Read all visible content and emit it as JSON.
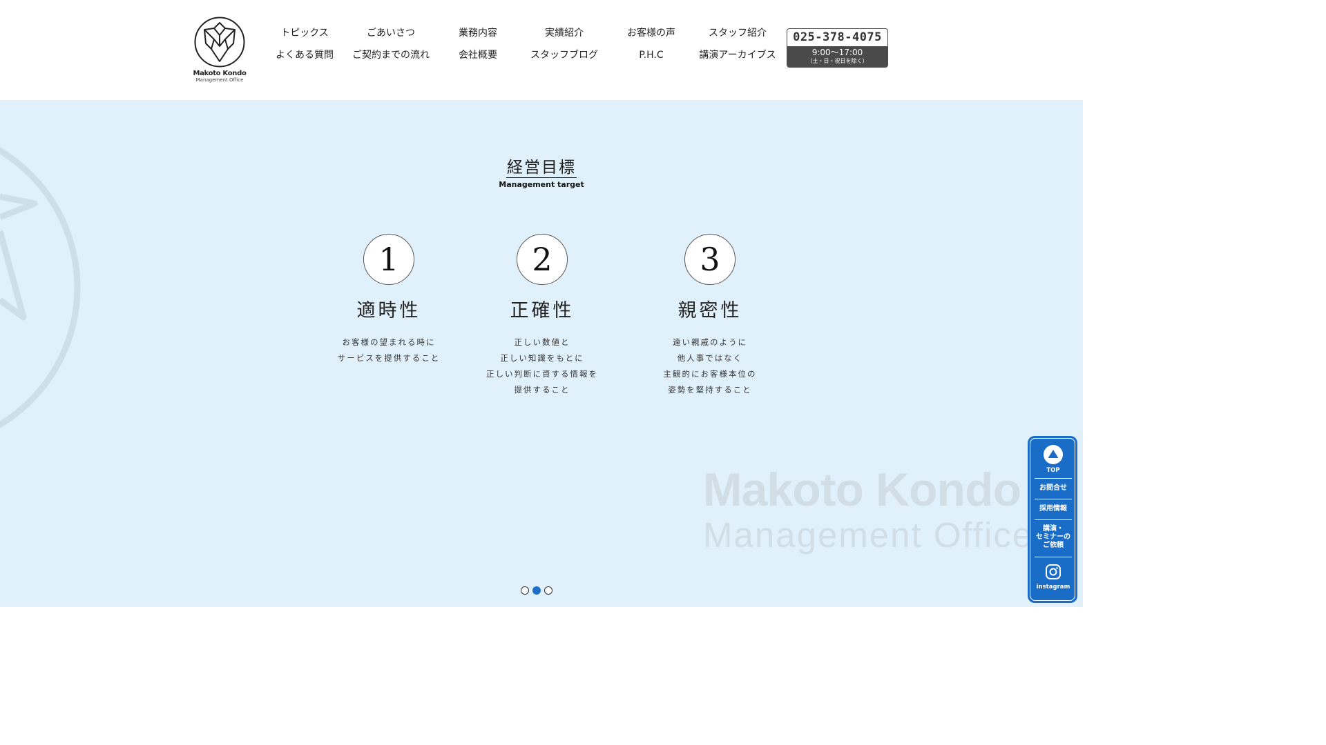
{
  "logo": {
    "name": "Makoto Kondo",
    "sub": "Management Office"
  },
  "nav": {
    "row1": [
      "トピックス",
      "ごあいさつ",
      "業務内容",
      "実績紹介",
      "お客様の声",
      "スタッフ紹介"
    ],
    "row2": [
      "よくある質問",
      "ご契約までの流れ",
      "会社概要",
      "スタッフブログ",
      "P.H.C",
      "講演アーカイブス"
    ]
  },
  "tel": {
    "number": "025-378-4075",
    "hours": "9:00〜17:00",
    "note": "（土・日・祝日を除く）"
  },
  "section": {
    "title": "経営目標",
    "subtitle": "Management target"
  },
  "targets": [
    {
      "number": "1",
      "title": "適時性",
      "lines": [
        "お客様の望まれる時に",
        "サービスを提供すること"
      ]
    },
    {
      "number": "2",
      "title": "正確性",
      "lines": [
        "正しい数値と",
        "正しい知識をもとに",
        "正しい判断に資する情報を",
        "提供すること"
      ]
    },
    {
      "number": "3",
      "title": "親密性",
      "lines": [
        "遠い親戚のように",
        "他人事ではなく",
        "主観的にお客様本位の",
        "姿勢を堅持すること"
      ]
    }
  ],
  "watermark": {
    "line1": "Makoto Kondo",
    "line2": "Management Office"
  },
  "slider": {
    "count": 3,
    "active": 2
  },
  "sidebar": {
    "top": "TOP",
    "contact": "お問合せ",
    "recruit": "採用情報",
    "seminar_lines": [
      "講演・",
      "セミナーの",
      "ご依頼"
    ],
    "instagram": "instagram"
  },
  "colors": {
    "hero_bg": "#e1f1fc",
    "accent": "#1a6dc7",
    "tel_dark": "#4a4a4a",
    "watermark": "#d2dee6"
  }
}
